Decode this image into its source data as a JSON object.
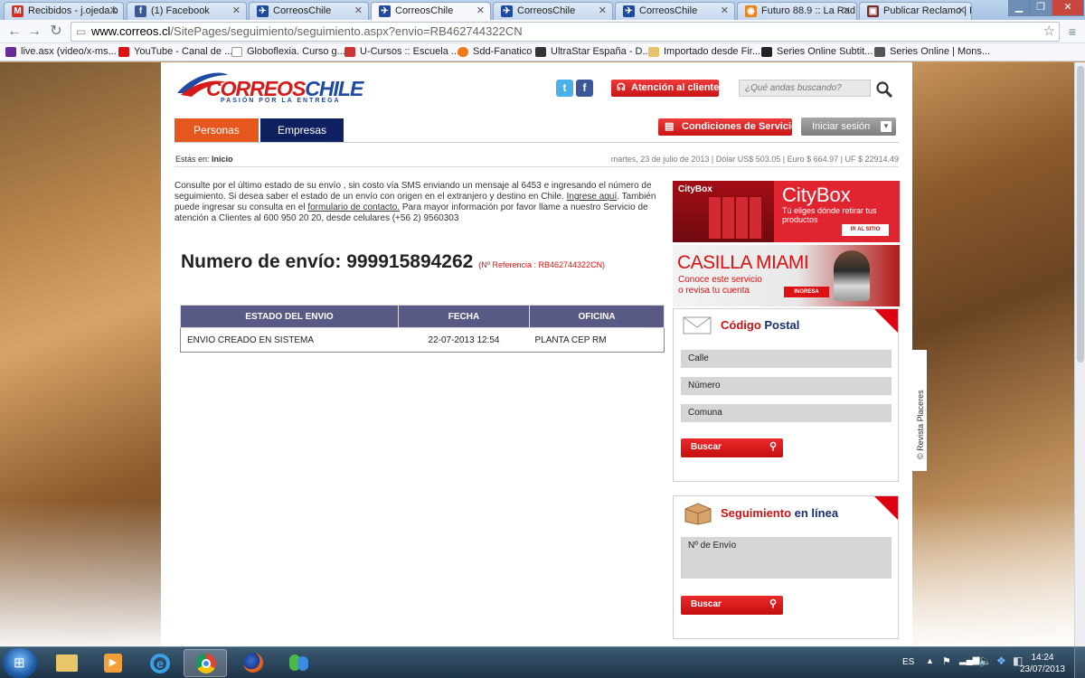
{
  "browser": {
    "tabs": [
      {
        "label": "Recibidos - j.ojeda.b",
        "icon": "gmail-icon",
        "color": "#d93025"
      },
      {
        "label": "(1) Facebook",
        "icon": "facebook-icon",
        "color": "#3b5998"
      },
      {
        "label": "CorreosChile",
        "icon": "correos-icon",
        "color": "#1e4aa0"
      },
      {
        "label": "CorreosChile",
        "icon": "correos-icon",
        "color": "#1e4aa0",
        "active": true
      },
      {
        "label": "CorreosChile",
        "icon": "correos-icon",
        "color": "#1e4aa0"
      },
      {
        "label": "CorreosChile",
        "icon": "correos-icon",
        "color": "#1e4aa0"
      },
      {
        "label": "Futuro 88.9 :: La Rad",
        "icon": "radio-icon",
        "color": "#e8831b"
      },
      {
        "label": "Publicar Reclamo | R",
        "icon": "reclamo-icon",
        "color": "#7a2a2a"
      }
    ],
    "url_host": "www.correos.cl",
    "url_path": "/SitePages/seguimiento/seguimiento.aspx?envio=RB462744322CN",
    "bookmarks": [
      {
        "label": "live.asx (video/x-ms...",
        "color": "#6a2a9a"
      },
      {
        "label": "YouTube - Canal de ...",
        "color": "#d11"
      },
      {
        "label": "Globoflexia. Curso g...",
        "color": "#888"
      },
      {
        "label": "U-Cursos :: Escuela ...",
        "color": "#c33"
      },
      {
        "label": "Sdd-Fanatico",
        "color": "#f07a1a"
      },
      {
        "label": "UltraStar España - D...",
        "color": "#333"
      },
      {
        "label": "Importado desde Fir...",
        "color": "#e8c26a"
      },
      {
        "label": "Series Online Subtit...",
        "color": "#222"
      },
      {
        "label": "Series Online | Mons...",
        "color": "#555"
      }
    ]
  },
  "header": {
    "logo_text": "CORREOSCHILE",
    "logo_word1": "CORREOS",
    "logo_word2": "CHILE",
    "logo_tagline": "PASIÓN POR LA ENTREGA",
    "attention_label": "Atención al cliente",
    "search_placeholder": "¿Qué andas buscando?",
    "tab_personas": "Personas",
    "tab_empresas": "Empresas",
    "conditions_label": "Condiciones de Servicio",
    "login_label": "Iniciar sesión"
  },
  "breadcrumb": {
    "prefix": "Estás en:",
    "current": "Inicio"
  },
  "infoline": "martes, 23 de julio de 2013 | Dólar US$ 503.05 | Euro $ 664.97 | UF $ 22914.49",
  "intro": {
    "text1": "Consulte por el último estado de su envío , sin costo vía SMS enviando un mensaje al 6453 e ingresando el número de seguimiento. Si desea saber el estado de un envío con origen en el extranjero y destino en Chile.",
    "link1": "Ingrese aquí",
    "text2": ". También puede ingresar su consulta en el",
    "link2": "formulario de contacto.",
    "text3": " Para mayor información por favor llame a nuestro Servicio de atención a Clientes al 600 950 20 20, desde celulares (+56 2) 9560303"
  },
  "tracking": {
    "label": "Numero de envío: 999915894262",
    "reference": "(Nº Referencia : RB462744322CN)"
  },
  "status_table": {
    "headers": [
      "ESTADO DEL ENVIO",
      "FECHA",
      "OFICINA"
    ],
    "rows": [
      [
        "ENVIO CREADO EN SISTEMA",
        "22-07-2013 12:54",
        "PLANTA CEP RM"
      ]
    ]
  },
  "banners": {
    "citybox": {
      "title": "CityBox",
      "subtitle": "Tú eliges dónde retirar tus productos",
      "cta": "IR AL SITIO"
    },
    "miami": {
      "title": "CASILLA MIAMI",
      "subtitle1": "Conoce este servicio",
      "subtitle2": "o revisa tu cuenta",
      "cta": "INGRESA"
    }
  },
  "codigo_postal": {
    "title_red": "Código",
    "title_blue": "Postal",
    "fields": [
      "Calle",
      "Número",
      "Comuna"
    ],
    "button": "Buscar"
  },
  "seguimiento": {
    "title_red": "Seguimiento",
    "title_blue": "en línea",
    "field": "Nº de Envío",
    "button": "Buscar"
  },
  "photo_credit": "© Revista Placeres",
  "taskbar": {
    "lang": "ES",
    "time": "14:24",
    "date": "23/07/2013"
  }
}
